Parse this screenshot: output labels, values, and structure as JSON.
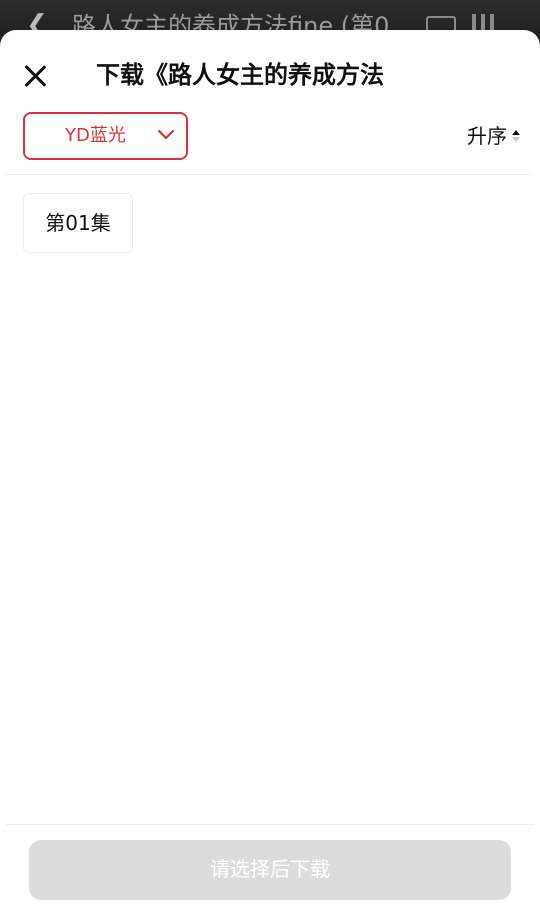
{
  "background": {
    "title": "路人女主的养成方法fine (第0"
  },
  "sheet": {
    "title": "下载《路人女主的养成方法",
    "source": {
      "selected": "YD蓝光"
    },
    "sort": {
      "label": "升序"
    },
    "episodes": [
      {
        "label": "第01集"
      }
    ],
    "download_button": "请选择后下载"
  },
  "colors": {
    "accent": "#d8323a",
    "disabled_button": "#dcdcdc"
  }
}
